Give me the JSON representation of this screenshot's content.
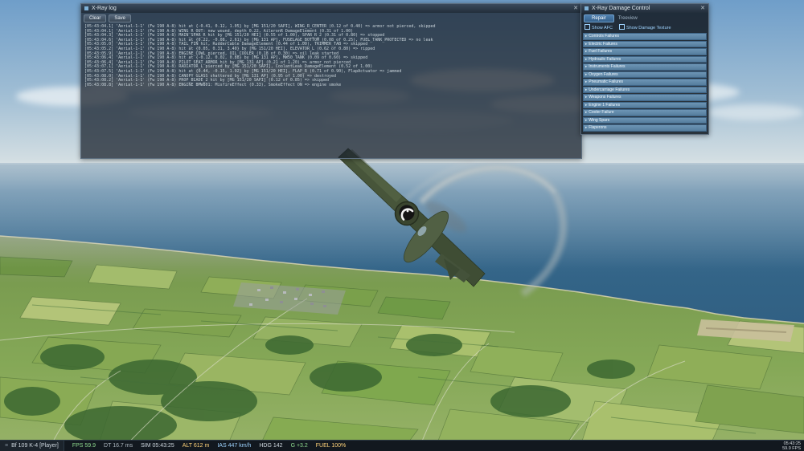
{
  "log_window": {
    "title": "X-Ray log",
    "buttons": [
      "Clear",
      "Save"
    ],
    "lines": [
      "[05:43:04.1] 'Aerial-1-1' (Fw 190 A-8) hit at {-0.41, 0.12, 1.05} by [MG 151/20 SAPI], WING_R_CENTER (0.12 of 0.40) => armor not pierced, skipped",
      "[05:43:04.1] 'Aerial-1-1' (Fw 190 A-8) WING_R_OUT: new wound, depth 0.22, AileronR DamageElement (0.31 of 1.00)",
      "[05:43:04.3] 'Aerial-1-1' (Fw 190 A-8) MAIN_SPAR_R hit by [MG 151/20 HEI] (0.55 of 1.00), SPAR_R_2 (0.31 of 0.80) => stopped",
      "[05:43:04.6] 'Aerial-1-1' (Fw 190 A-8) hit at {0.22, -0.08, 2.61} by [MG 131 AP], FUSELAGE_BOTTOM (0.08 of 0.25), FUEL_TANK_PROTECTED => no leak",
      "[05:43:05.0] 'Aerial-1-1' (Fw 190 A-8) TAIL_FIN hit, RudderCable DamageElement (0.44 of 1.00), TRIMMER_TAB => skipped",
      "[05:43:05.2] 'Aerial-1-1' (Fw 190 A-8) hit at {0.05, 0.31, 3.40} by [MG 151/20 HEI], ELEVATOR_L (0.62 of 0.80) => ripped",
      "[05:43:05.9] 'Aerial-1-1' (Fw 190 A-8) ENGINE_COWL pierced, OIL_COOLER (0.18 of 0.30) => oil leak started",
      "[05:43:06.4] 'Aerial-1-1' (Fw 190 A-8) hit at {-0.12, 0.02, 0.88} by [MG 131 AP], MW50_TANK (0.09 of 0.60) => skipped",
      "[05:43:06.4] 'Aerial-1-1' (Fw 190 A-8) PILOT_SEAT_ARMOR hit by [MG 131 AP] (0.21 of 1.20) => armor not pierced",
      "[05:43:07.1] 'Aerial-1-1' (Fw 190 A-8) RADIATOR_L pierced by [MG 151/20 SAPI], CoolantLeak DamageElement (0.52 of 1.00)",
      "[05:43:07.5] 'Aerial-1-1' (Fw 190 A-8) hit at {0.44, -0.15, 1.92} by [MG 151/20 HEI], FLAP_R (0.71 of 0.90), FlapActuator => jammed",
      "[05:43:08.0] 'Aerial-1-1' (Fw 190 A-8) CANOPY_GLASS shattered by [MG 131 AP] (0.95 of 1.00) => destroyed",
      "[05:43:08.2] 'Aerial-1-1' (Fw 190 A-8) PROP_BLADE_2 hit by [MG 151/20 SAPI] (0.12 of 0.85) => skipped",
      "[05:43:08.8] 'Aerial-1-1' (Fw 190 A-8) ENGINE BMW801: MisfireEffect (0.33), SmokeEffect ON => engine smoke"
    ]
  },
  "damage_panel": {
    "title": "X-Ray Damage Control",
    "repair_label": "Repair",
    "treeview_label": "Treeview",
    "checks": [
      "Show AFC",
      "Show Damage Texture"
    ],
    "items": [
      "Controls Failures",
      "Electric Failures",
      "Fuel Failures",
      "Hydraulic Failures",
      "Instruments Failures",
      "Oxygen Failures",
      "Pneumatic Failures",
      "Undercarriage Failures",
      "Weapons Failures",
      "Engine 1 Failures",
      "Cooler Failure",
      "Wing Spars",
      "Flaperons"
    ]
  },
  "status_bar": {
    "aircraft": "Bf 109 K-4 [Player]",
    "segments": [
      {
        "text": "FPS 59.9",
        "color": "#8fd98f"
      },
      {
        "text": "DT 16.7 ms",
        "color": "#aeb8c0"
      },
      {
        "text": "SIM 05:43:25",
        "color": "#cfd8df"
      },
      {
        "text": "ALT 612 m",
        "color": "#ffd37a"
      },
      {
        "text": "IAS 447 km/h",
        "color": "#9fd4ff"
      },
      {
        "text": "HDG 142",
        "color": "#cfd8df"
      },
      {
        "text": "G +3.2",
        "color": "#8fd98f"
      },
      {
        "text": "FUEL 100%",
        "color": "#ffd37a"
      }
    ],
    "clock": "05:43:25",
    "fps_small": "59.9 FPS"
  },
  "scene": {
    "colors": {
      "sky_top": "#6f9ec9",
      "sky_horizon": "#d9e2e4",
      "ocean": "#336487",
      "land": "#7aa04e",
      "smoke": "#b6bdbd",
      "panel_row_blue": "#5d88ad"
    }
  }
}
